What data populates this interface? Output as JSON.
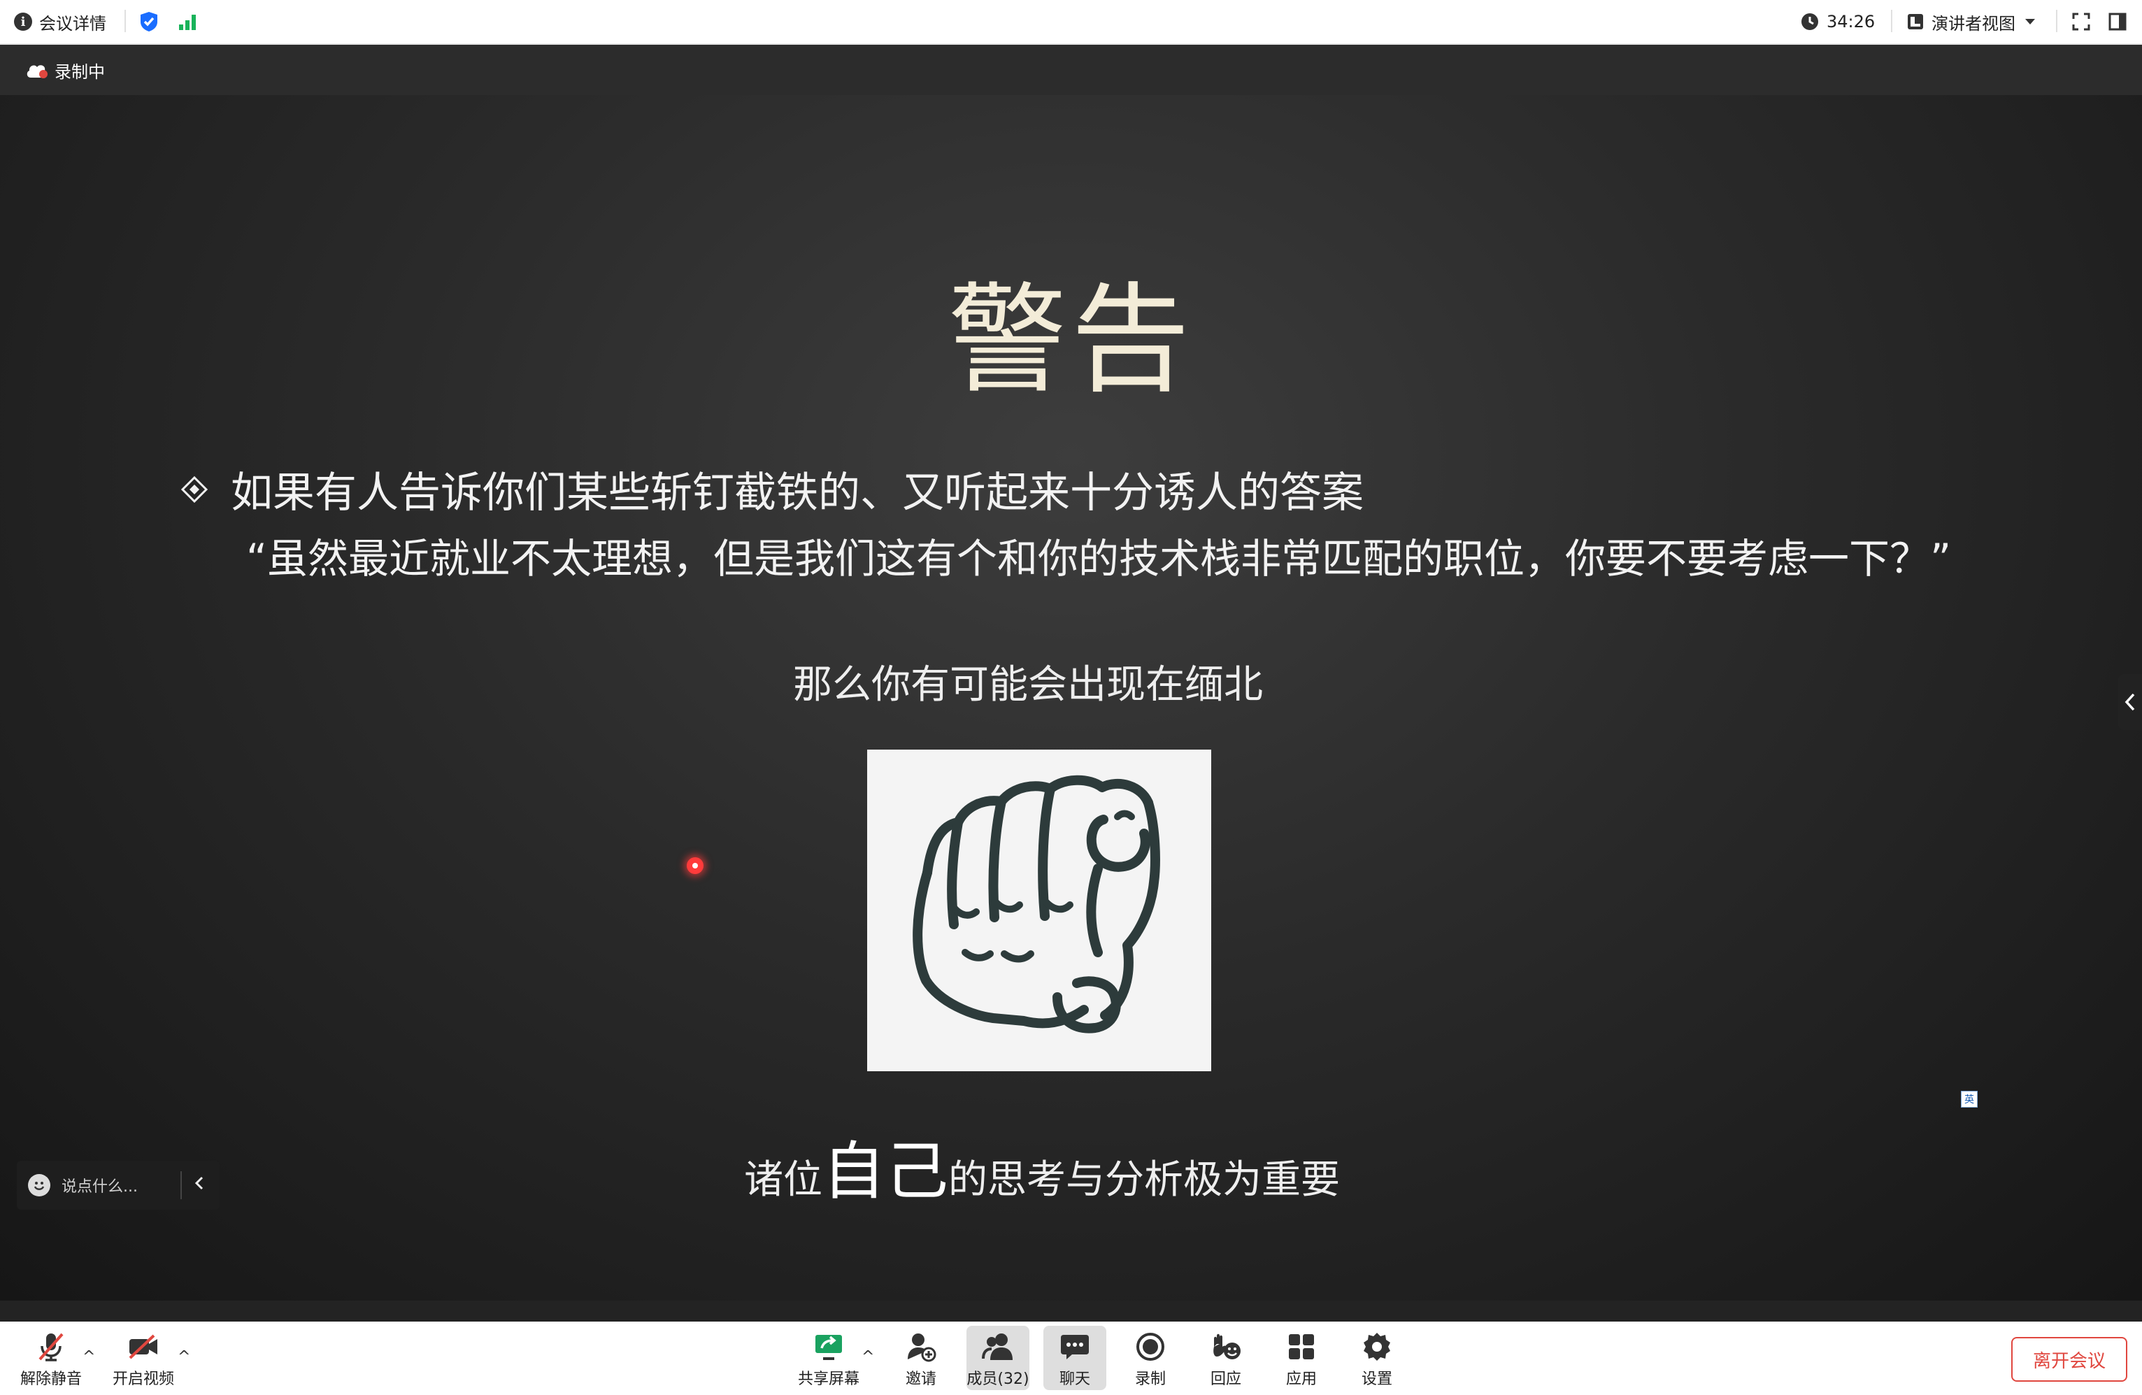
{
  "titlebar": {
    "meeting_info": "会议详情",
    "timer": "34:26",
    "view_mode": "演讲者视图",
    "colors": {
      "shield": "#1a6dff",
      "signal": "#18b35a"
    }
  },
  "recording": {
    "label": "录制中"
  },
  "slide": {
    "title": "警告",
    "bullet": "如果有人告诉你们某些斩钉截铁的、又听起来十分诱人的答案",
    "quote": "“虽然最近就业不太理想，但是我们这有个和你的技术栈非常匹配的职位，你要不要考虑一下？”",
    "line3": "那么你有可能会出现在缅北",
    "conclusion_pre": "诸位",
    "conclusion_big": "自己",
    "conclusion_post": "的思考与分析极为重要"
  },
  "overlay": {
    "chat_placeholder": "说点什么...",
    "ime_label": "英"
  },
  "toolbar": {
    "unmute": "解除静音",
    "start_video": "开启视频",
    "share_screen": "共享屏幕",
    "invite": "邀请",
    "members": "成员(32)",
    "chat": "聊天",
    "record": "录制",
    "react": "回应",
    "apps": "应用",
    "settings": "设置",
    "leave": "离开会议",
    "colors": {
      "share": "#1aa260",
      "leave": "#e0473f"
    }
  }
}
